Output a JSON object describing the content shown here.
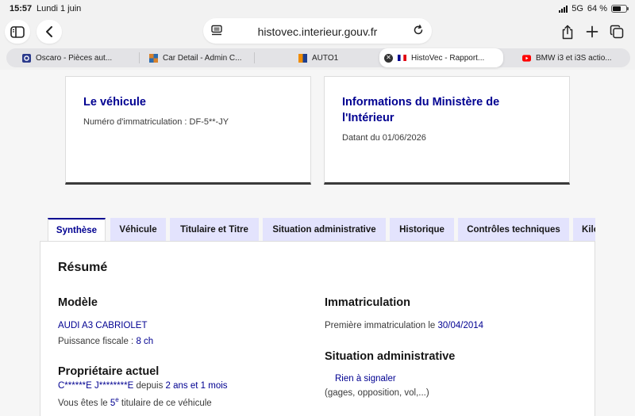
{
  "status": {
    "time": "15:57",
    "date": "Lundi 1 juin",
    "network": "5G",
    "battery": "64 %",
    "battery_level": 0.64
  },
  "browser": {
    "url": "histovec.interieur.gouv.fr",
    "tabs": [
      {
        "label": "Oscaro - Pièces aut...",
        "icon": "oscaro-icon",
        "color": "#2b3a8c"
      },
      {
        "label": "Car Detail - Admin C...",
        "icon": "admin-icon",
        "color": "#d9822b"
      },
      {
        "label": "AUTO1",
        "icon": "auto1-icon",
        "color": "#f08c00"
      },
      {
        "label": "HistoVec - Rapport...",
        "icon": "flag-fr-icon",
        "color": "#000091",
        "active": true
      },
      {
        "label": "BMW i3 et i3S actio...",
        "icon": "youtube-icon",
        "color": "#ff0000"
      }
    ]
  },
  "cards": {
    "vehicle": {
      "title": "Le véhicule",
      "subtitle": "Numéro d'immatriculation : DF-5**-JY"
    },
    "ministry": {
      "title_line1": "Informations du Ministère de",
      "title_line2": "l'Intérieur",
      "subtitle": "Datant du 01/06/2026"
    }
  },
  "page_tabs": [
    {
      "label": "Synthèse",
      "active": true
    },
    {
      "label": "Véhicule"
    },
    {
      "label": "Titulaire et Titre"
    },
    {
      "label": "Situation administrative"
    },
    {
      "label": "Historique"
    },
    {
      "label": "Contrôles techniques"
    },
    {
      "label": "Kilo"
    }
  ],
  "summary": {
    "heading": "Résumé",
    "model": {
      "heading": "Modèle",
      "name": "AUDI A3 CABRIOLET",
      "power_label": "Puissance fiscale : ",
      "power_value": "8 ch"
    },
    "owner": {
      "heading": "Propriétaire actuel",
      "name": "C******E J********E",
      "since_label": " depuis ",
      "since_value": "2 ans et 1 mois",
      "holder_prefix": "Vous êtes le ",
      "holder_rank": "5",
      "holder_rank_sup": "e",
      "holder_suffix": " titulaire de ce véhicule"
    },
    "registration": {
      "heading": "Immatriculation",
      "first_label": "Première immatriculation le ",
      "first_date": "30/04/2014"
    },
    "admin": {
      "heading": "Situation administrative",
      "status": "Rien à signaler",
      "details": "(gages, opposition, vol,...)"
    }
  }
}
